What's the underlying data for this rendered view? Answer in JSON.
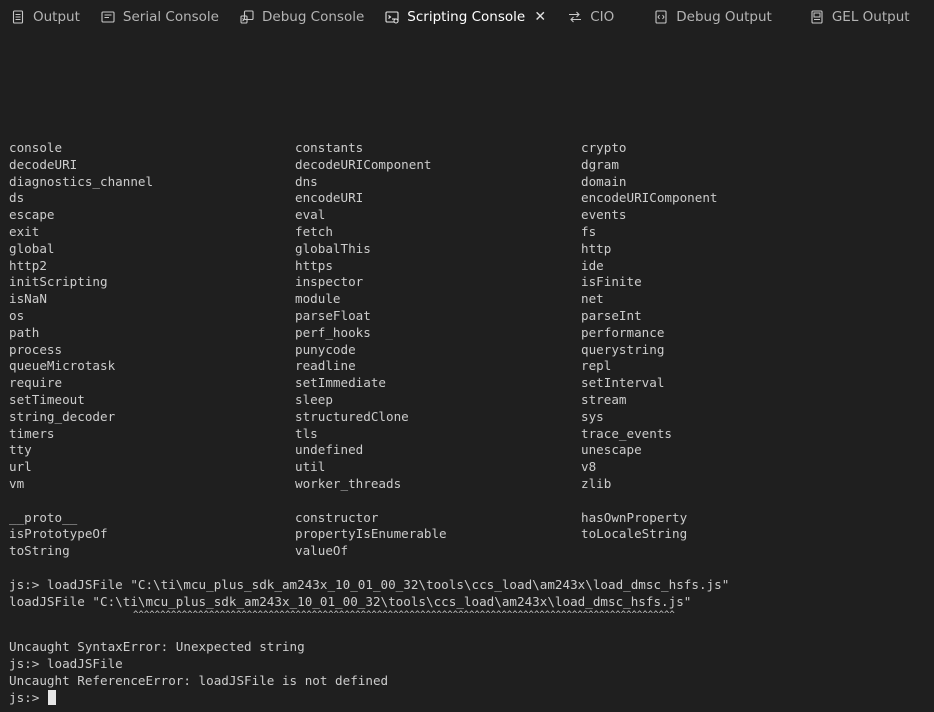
{
  "tabs": [
    {
      "label": "Output",
      "icon": "output-icon",
      "active": false
    },
    {
      "label": "Serial Console",
      "icon": "serial-console-icon",
      "active": false
    },
    {
      "label": "Debug Console",
      "icon": "debug-console-icon",
      "active": false
    },
    {
      "label": "Scripting Console",
      "icon": "scripting-console-icon",
      "active": true
    },
    {
      "label": "CIO",
      "icon": "cio-icon",
      "active": false
    },
    {
      "label": "Debug Output",
      "icon": "debug-output-icon",
      "active": false
    },
    {
      "label": "GEL Output",
      "icon": "gel-output-icon",
      "active": false
    }
  ],
  "close_glyph": "✕",
  "globals": [
    [
      "console",
      "constants",
      "crypto"
    ],
    [
      "decodeURI",
      "decodeURIComponent",
      "dgram"
    ],
    [
      "diagnostics_channel",
      "dns",
      "domain"
    ],
    [
      "ds",
      "encodeURI",
      "encodeURIComponent"
    ],
    [
      "escape",
      "eval",
      "events"
    ],
    [
      "exit",
      "fetch",
      "fs"
    ],
    [
      "global",
      "globalThis",
      "http"
    ],
    [
      "http2",
      "https",
      "ide"
    ],
    [
      "initScripting",
      "inspector",
      "isFinite"
    ],
    [
      "isNaN",
      "module",
      "net"
    ],
    [
      "os",
      "parseFloat",
      "parseInt"
    ],
    [
      "path",
      "perf_hooks",
      "performance"
    ],
    [
      "process",
      "punycode",
      "querystring"
    ],
    [
      "queueMicrotask",
      "readline",
      "repl"
    ],
    [
      "require",
      "setImmediate",
      "setInterval"
    ],
    [
      "setTimeout",
      "sleep",
      "stream"
    ],
    [
      "string_decoder",
      "structuredClone",
      "sys"
    ],
    [
      "timers",
      "tls",
      "trace_events"
    ],
    [
      "tty",
      "undefined",
      "unescape"
    ],
    [
      "url",
      "util",
      "v8"
    ],
    [
      "vm",
      "worker_threads",
      "zlib"
    ]
  ],
  "prototype_members": [
    [
      "__proto__",
      "constructor",
      "hasOwnProperty"
    ],
    [
      "isPrototypeOf",
      "propertyIsEnumerable",
      "toLocaleString"
    ],
    [
      "toString",
      "valueOf",
      ""
    ]
  ],
  "log": {
    "command1": "js:> loadJSFile \"C:\\ti\\mcu_plus_sdk_am243x_10_01_00_32\\tools\\ccs_load\\am243x\\load_dmsc_hsfs.js\"",
    "echo1": "loadJSFile \"C:\\ti\\mcu_plus_sdk_am243x_10_01_00_32\\tools\\ccs_load\\am243x\\load_dmsc_hsfs.js\"",
    "carets": "^^^^^^^^^^^^^^^^^^^^^^^^^^^^^^^^^^^^^^^^^^^^^^^^^^^^^^^^^^^^^^^^^^^^^^^^^^^^^^^^^^^^^^^^^^^^^^^^^^^^",
    "error1": "Uncaught SyntaxError: Unexpected string",
    "command2": "js:> loadJSFile",
    "error2": "Uncaught ReferenceError: loadJSFile is not defined",
    "prompt": "js:> "
  }
}
